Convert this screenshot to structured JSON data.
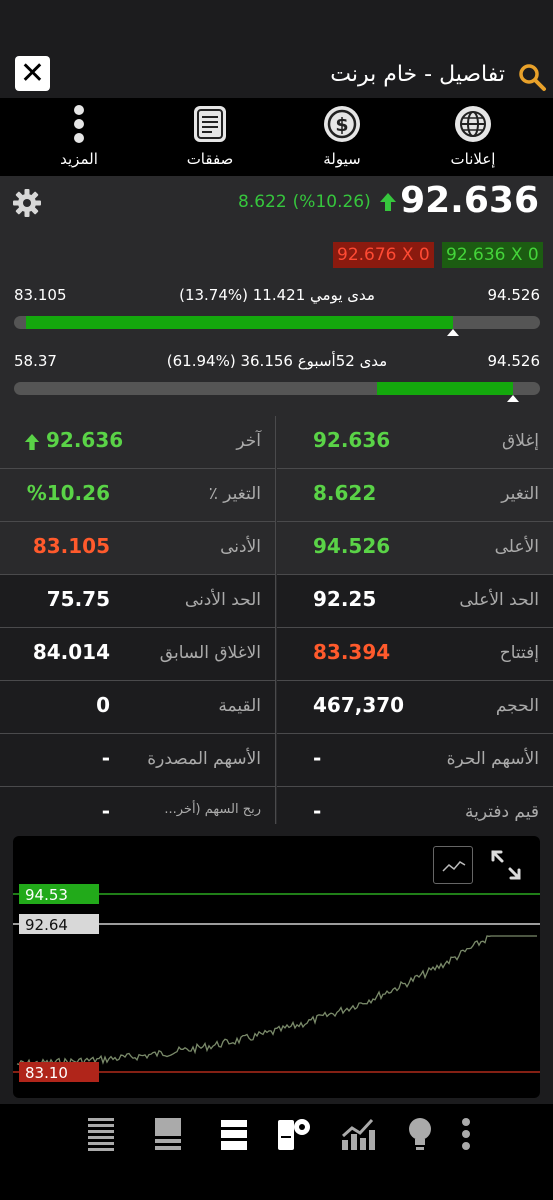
{
  "header": {
    "title": "تفاصيل - خام برنت"
  },
  "toolbar": {
    "items": [
      {
        "label": "إعلانات",
        "icon": "globe-icon"
      },
      {
        "label": "سيولة",
        "icon": "dollar-icon"
      },
      {
        "label": "صفقات",
        "icon": "document-icon"
      },
      {
        "label": "المزيد",
        "icon": "more-vertical-icon"
      }
    ]
  },
  "quote": {
    "last": "92.636",
    "change": "8.622",
    "change_pct": "(%10.26)",
    "ask": "92.676 X 0",
    "bid": "92.636 X 0",
    "daily_range": {
      "low": "83.105",
      "high": "94.526",
      "label": "مدى يومي 11.421 (%13.74)",
      "position": 0.835
    },
    "week52_range": {
      "low": "58.37",
      "high": "94.526",
      "label": "مدى 52أسبوع 36.156 (%61.94)",
      "position": 0.948
    }
  },
  "stats": [
    {
      "right_label": "إغلاق",
      "right_value": "92.636",
      "right_color": "#5ad347",
      "left_label": "آخر",
      "left_value": "92.636",
      "left_color": "#5ad347",
      "left_arrow": true
    },
    {
      "right_label": "التغير",
      "right_value": "8.622",
      "right_color": "#5ad347",
      "left_label": "التغير ٪",
      "left_value": "%10.26",
      "left_color": "#5ad347"
    },
    {
      "right_label": "الأعلى",
      "right_value": "94.526",
      "right_color": "#5ad347",
      "left_label": "الأدنى",
      "left_value": "83.105",
      "left_color": "#ff5a2c"
    },
    {
      "right_label": "الحد الأعلى",
      "right_value": "92.25",
      "right_color": "#ffffff",
      "left_label": "الحد الأدنى",
      "left_value": "75.75",
      "left_color": "#ffffff"
    },
    {
      "right_label": "إفتتاح",
      "right_value": "83.394",
      "right_color": "#ff5a2c",
      "left_label": "الاغلاق السابق",
      "left_value": "84.014",
      "left_color": "#ffffff"
    },
    {
      "right_label": "الحجم",
      "right_value": "467,370",
      "right_color": "#ffffff",
      "left_label": "القيمة",
      "left_value": "0",
      "left_color": "#ffffff"
    },
    {
      "right_label": "الأسهم الحرة",
      "right_value": "-",
      "right_color": "#ffffff",
      "left_label": "الأسهم المصدرة",
      "left_value": "-",
      "left_color": "#ffffff"
    },
    {
      "right_label": "قيم دفترية",
      "right_value": "-",
      "right_color": "#ffffff",
      "left_label": "ربح السهم (أخر...",
      "left_value": "-",
      "left_color": "#ffffff"
    }
  ],
  "chart": {
    "high_label": "94.53",
    "last_label": "92.64",
    "low_label": "83.10"
  },
  "colors": {
    "up": "#5ad347",
    "down": "#ff5a2c",
    "accent": "#e8a12a"
  }
}
